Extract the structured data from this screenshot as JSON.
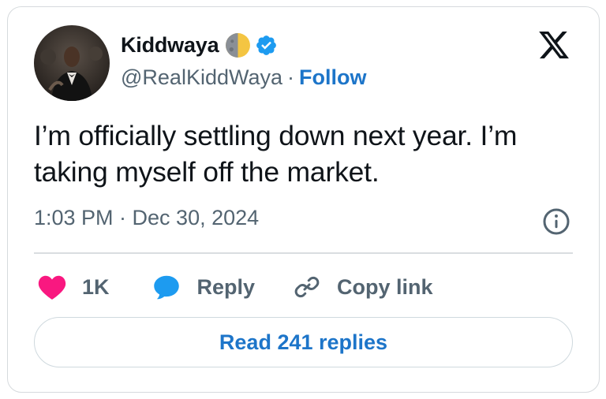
{
  "author": {
    "display_name": "Kiddwaya",
    "handle": "@RealKiddWaya",
    "separator": "·",
    "follow_label": "Follow",
    "avatar_icon": "avatar-photo",
    "name_emoji_icon": "moon-icon",
    "verified_icon": "verified-badge-icon"
  },
  "platform": {
    "logo_icon": "x-logo-icon"
  },
  "tweet": {
    "text": "I’m officially settling down next year. I’m taking myself off the market.",
    "timestamp": "1:03 PM · Dec 30, 2024"
  },
  "actions": {
    "likes_count": "1K",
    "reply_label": "Reply",
    "copy_link_label": "Copy link"
  },
  "footer": {
    "read_replies_label": "Read 241 replies"
  },
  "colors": {
    "link_blue": "#1d75c9",
    "heart_pink": "#f91880",
    "reply_blue": "#1d9bf0",
    "muted_gray": "#536471",
    "border_gray": "#cfd9de"
  }
}
